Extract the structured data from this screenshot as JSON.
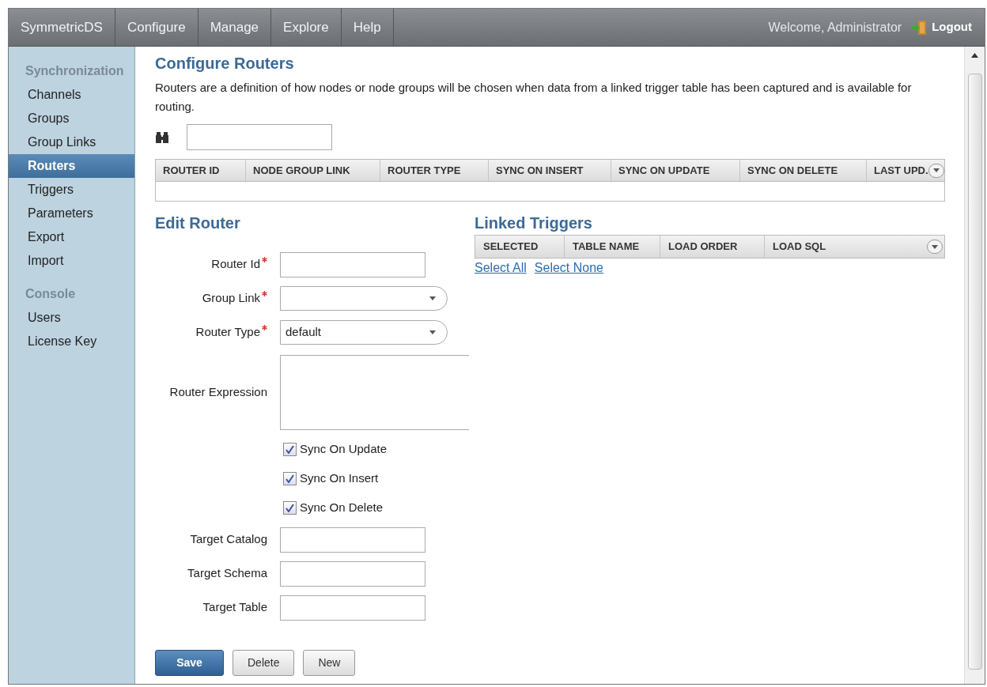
{
  "nav": {
    "items": [
      {
        "label": "SymmetricDS",
        "selected": false
      },
      {
        "label": "Configure",
        "selected": false
      },
      {
        "label": "Manage",
        "selected": false
      },
      {
        "label": "Explore",
        "selected": false
      },
      {
        "label": "Help",
        "selected": false
      }
    ],
    "welcome": "Welcome, Administrator",
    "logout": "Logout"
  },
  "sidebar": {
    "sections": [
      {
        "heading": "Synchronization",
        "items": [
          {
            "label": "Channels",
            "selected": false
          },
          {
            "label": "Groups",
            "selected": false
          },
          {
            "label": "Group Links",
            "selected": false
          },
          {
            "label": "Routers",
            "selected": true
          },
          {
            "label": "Triggers",
            "selected": false
          },
          {
            "label": "Parameters",
            "selected": false
          },
          {
            "label": "Export",
            "selected": false
          },
          {
            "label": "Import",
            "selected": false
          }
        ]
      },
      {
        "heading": "Console",
        "items": [
          {
            "label": "Users",
            "selected": false
          },
          {
            "label": "License Key",
            "selected": false
          }
        ]
      }
    ]
  },
  "title": "Configure Routers",
  "description": "Routers are a definition of how nodes or node groups will be chosen when data from a linked trigger table has been captured and is available for routing.",
  "routers_table": {
    "columns": [
      "ROUTER ID",
      "NODE GROUP LINK",
      "ROUTER TYPE",
      "SYNC ON INSERT",
      "SYNC ON UPDATE",
      "SYNC ON DELETE",
      "LAST UPD."
    ]
  },
  "edit_router": {
    "title": "Edit Router",
    "fields": [
      {
        "kind": "text",
        "label": "Router Id",
        "required": true
      },
      {
        "kind": "select",
        "label": "Group Link",
        "required": true
      },
      {
        "kind": "select",
        "label": "Router Type",
        "required": true,
        "value": "default"
      },
      {
        "kind": "textarea",
        "label": "Router Expression",
        "required": false
      },
      {
        "kind": "checkbox",
        "label": "Sync On Update",
        "checked": true
      },
      {
        "kind": "checkbox",
        "label": "Sync On Insert",
        "checked": true
      },
      {
        "kind": "checkbox",
        "label": "Sync On Delete",
        "checked": true
      },
      {
        "kind": "text",
        "label": "Target Catalog",
        "required": false
      },
      {
        "kind": "text",
        "label": "Target Schema",
        "required": false
      },
      {
        "kind": "text",
        "label": "Target Table",
        "required": false
      }
    ],
    "buttons": [
      {
        "label": "Save",
        "kind": "primary"
      },
      {
        "label": "Delete",
        "kind": "default"
      },
      {
        "label": "New",
        "kind": "default"
      }
    ]
  },
  "linked_triggers": {
    "title": "Linked Triggers",
    "columns": [
      "SELECTED",
      "TABLE NAME",
      "LOAD ORDER",
      "LOAD SQL"
    ],
    "links": [
      "Select All",
      "Select None"
    ]
  }
}
